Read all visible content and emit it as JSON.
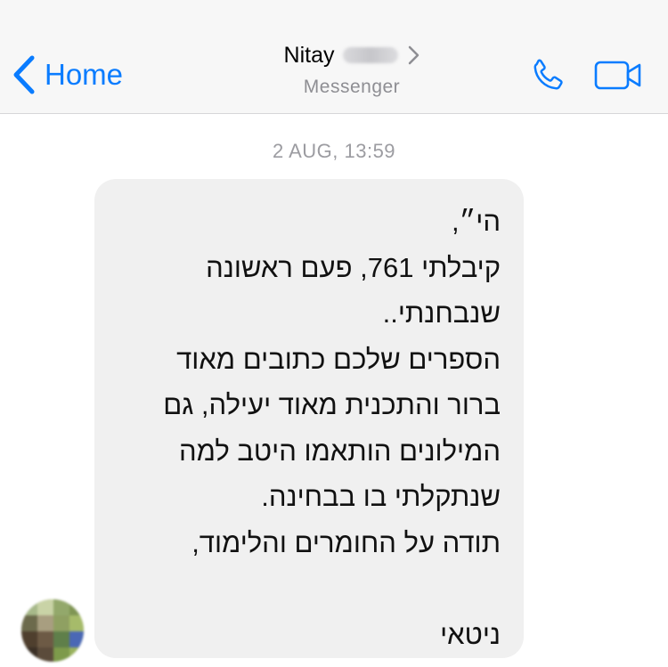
{
  "header": {
    "back_label": "Home",
    "contact_name": "Nitay",
    "subtitle": "Messenger"
  },
  "conversation": {
    "timestamp": "2 AUG, 13:59",
    "message_lines": [
      "הי״,",
      "קיבלתי 761, פעם ראשונה",
      "שנבחנתי..",
      "הספרים שלכם כתובים מאוד",
      "ברור והתכנית מאוד יעילה, גם",
      "המילונים הותאמו היטב למה",
      "שנתקלתי בו בבחינה.",
      "תודה על החומרים והלימוד,",
      "",
      "ניטאי"
    ]
  },
  "icons": {
    "back": "chevron-left-icon",
    "details": "chevron-right-icon",
    "call": "phone-icon",
    "video": "video-camera-icon"
  },
  "colors": {
    "accent": "#0a7cff",
    "bubble": "#f0f0f0",
    "navbar": "#f7f7f7",
    "muted_text": "#8e8e93"
  }
}
